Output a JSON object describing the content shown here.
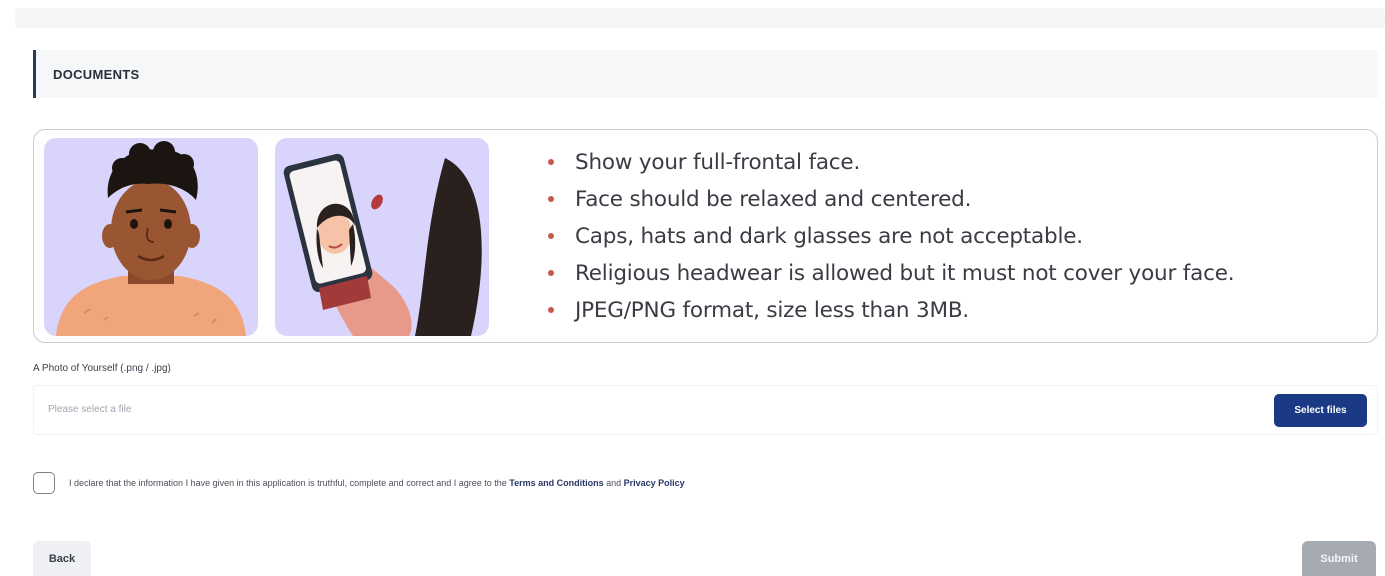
{
  "section": {
    "title": "DOCUMENTS"
  },
  "photo_guidelines": {
    "rules": [
      "Show your full-frontal face.",
      "Face should be relaxed and centered.",
      "Caps, hats and dark glasses are not acceptable.",
      "Religious headwear is allowed but it must not cover your face.",
      "JPEG/PNG format, size less than 3MB."
    ]
  },
  "photo_upload": {
    "label": "A Photo of Yourself (.png / .jpg)",
    "placeholder": "Please select a file",
    "button_label": "Select files"
  },
  "declaration": {
    "text_before": "I declare that the information I have given in this application is truthful, complete and correct and I agree to the ",
    "terms_link": "Terms and Conditions",
    "joiner": " and ",
    "privacy_link": "Privacy Policy",
    "checked": false
  },
  "actions": {
    "back_label": "Back",
    "submit_label": "Submit"
  },
  "colors": {
    "primary": "#1b3a86",
    "accent_border": "#273a5c",
    "illustration_bg": "#d9d4fb",
    "bullet": "#c25b4c",
    "disabled": "#a6aab3"
  }
}
